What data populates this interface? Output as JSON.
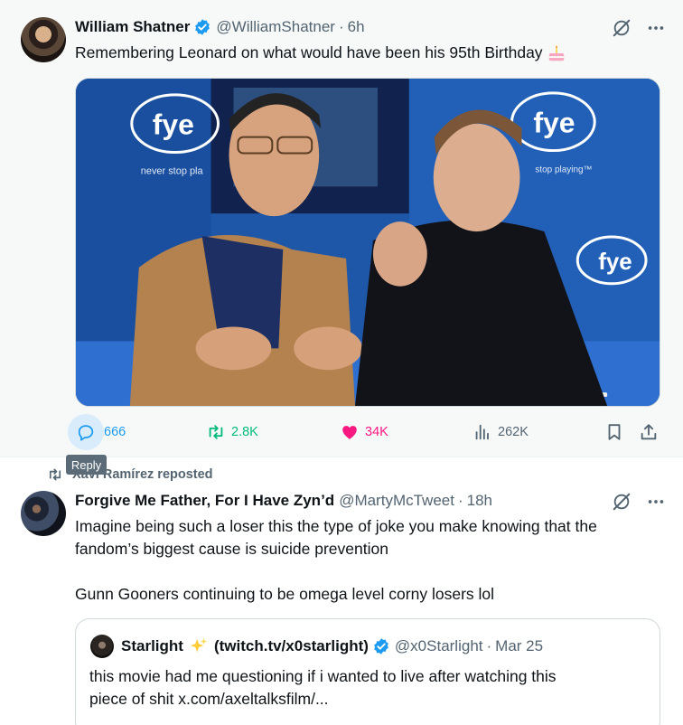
{
  "tweet1": {
    "author_name": "William Shatner",
    "handle": "@WilliamShatner",
    "separator": "·",
    "time": "6h",
    "text": "Remembering Leonard on what would have been his 95th Birthday",
    "actions": {
      "replies": "666",
      "reposts": "2.8K",
      "likes": "34K",
      "views": "262K"
    },
    "tooltip": "Reply",
    "photo_banner_texts": [
      "fye",
      "fye",
      "fye",
      "fye"
    ],
    "photo_slogan_left": "never stop pla",
    "photo_slogan_right": "stop playing™"
  },
  "repost_context": {
    "text": "Xavi Ramírez reposted"
  },
  "tweet2": {
    "author_name": "Forgive Me Father, For I Have Zyn’d",
    "handle": "@MartyMcTweet",
    "separator": "·",
    "time": "18h",
    "text_line1": "Imagine being such a loser this the type of joke you make knowing that the",
    "text_line2": "fandom’s biggest cause is suicide prevention",
    "text_line3": "Gunn Gooners continuing to be omega level corny losers lol"
  },
  "quoted": {
    "author_name": "Starlight",
    "author_suffix": "(twitch.tv/x0starlight)",
    "handle": "@x0Starlight",
    "separator": "·",
    "time": "Mar 25",
    "text_line1": "this movie had me questioning if i wanted to live after watching this",
    "text_line2": "piece of shit  x.com/axeltalksfilm/..."
  },
  "colors": {
    "accent_blue": "#1d9bf0",
    "retweet_green": "#00ba7c",
    "like_pink": "#f91880",
    "secondary_text": "#536471"
  },
  "icons": [
    "verified-badge-icon",
    "grok-icon",
    "more-icon",
    "reply-icon",
    "retweet-icon",
    "heart-icon",
    "views-icon",
    "bookmark-icon",
    "share-icon",
    "cake-icon",
    "sparkles-icon"
  ]
}
